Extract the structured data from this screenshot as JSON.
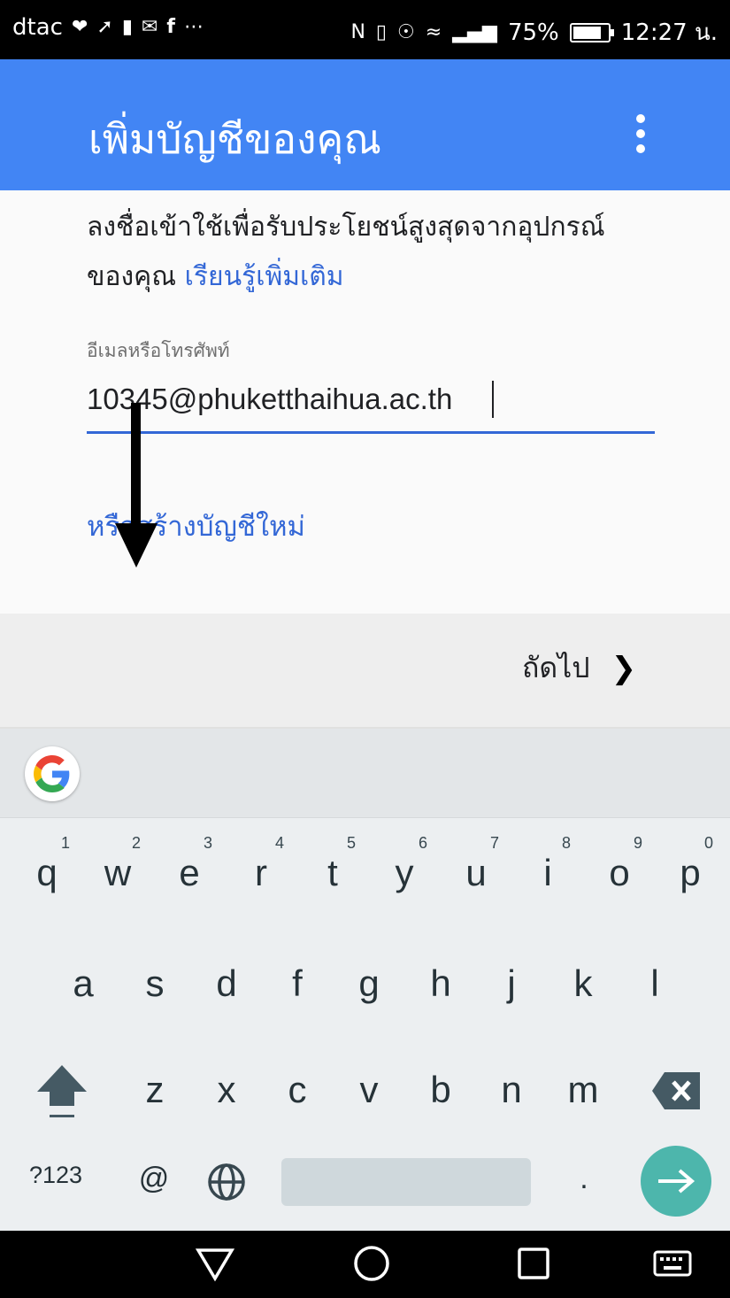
{
  "status_bar": {
    "carrier": "dtac",
    "battery_percent": "75%",
    "battery_level": 0.75,
    "time": "12:27 น.",
    "icons_left": [
      "heart-icon",
      "pin-icon",
      "phone-alert-icon",
      "gmail-icon",
      "facebook-icon",
      "more-icon"
    ],
    "icons_right": [
      "nfc-icon",
      "vibrate-icon",
      "eye-icon",
      "wifi-icon",
      "signal-icon",
      "battery-icon"
    ]
  },
  "app_bar": {
    "title": "เพิ่มบัญชีของคุณ",
    "color": "#4285f4"
  },
  "content": {
    "description": "ลงชื่อเข้าใช้เพื่อรับประโยชน์สูงสุดจากอุปกรณ์ของคุณ",
    "learn_more": "เรียนรู้เพิ่มเติม",
    "field_label": "อีเมลหรือโทรศัพท์",
    "email_value": "10345@phuketthaihua.ac.th",
    "create_account": "หรือสร้างบัญชีใหม่",
    "link_color": "#3367d6"
  },
  "next_bar": {
    "label": "ถัดไป"
  },
  "keyboard": {
    "row1": [
      {
        "ch": "q",
        "num": "1"
      },
      {
        "ch": "w",
        "num": "2"
      },
      {
        "ch": "e",
        "num": "3"
      },
      {
        "ch": "r",
        "num": "4"
      },
      {
        "ch": "t",
        "num": "5"
      },
      {
        "ch": "y",
        "num": "6"
      },
      {
        "ch": "u",
        "num": "7"
      },
      {
        "ch": "i",
        "num": "8"
      },
      {
        "ch": "o",
        "num": "9"
      },
      {
        "ch": "p",
        "num": "0"
      }
    ],
    "row2": [
      "a",
      "s",
      "d",
      "f",
      "g",
      "h",
      "j",
      "k",
      "l"
    ],
    "row3": [
      "z",
      "x",
      "c",
      "v",
      "b",
      "n",
      "m"
    ],
    "symbols_label": "?123",
    "at_label": "@",
    "period_label": ".",
    "enter_color": "#4db6ac"
  },
  "nav_bar": {
    "buttons": [
      "back-icon",
      "home-icon",
      "recents-icon",
      "keyboard-icon"
    ]
  }
}
